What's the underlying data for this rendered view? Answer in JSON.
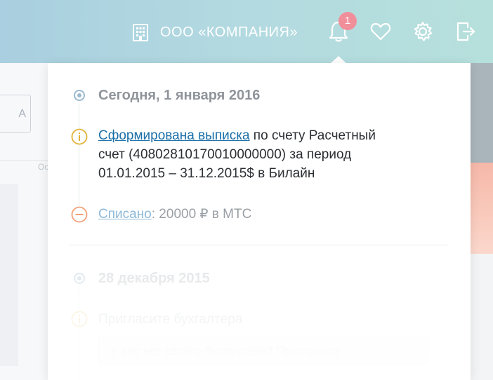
{
  "header": {
    "company_name": "ООО «КОМПАНИЯ»",
    "notification_count": "1",
    "icons": [
      "building-icon",
      "bell-icon",
      "heart-icon",
      "gear-icon",
      "logout-icon"
    ],
    "gradient_colors": [
      "#a9cfe0",
      "#b6e0dc"
    ],
    "badge_color": "#f08f9a"
  },
  "background": {
    "button_fragment": "А",
    "label_fragment": "Ос"
  },
  "notifications": {
    "groups": [
      {
        "date": "Сегодня, 1 января 2016",
        "items": [
          {
            "type": "info",
            "link": "Сформирована выписка",
            "line1": " по счету Расчетный",
            "line2": "счет (40802810170010000000) за период",
            "line3": "01.01.2015 – 31.12.2015$ в Билайн"
          },
          {
            "type": "debit",
            "link": "Списано",
            "rest": ": 20000 ₽ в МТС"
          }
        ]
      },
      {
        "date": "28 декабря 2015",
        "items": [
          {
            "type": "info",
            "text": "Пригласите бухгалтера",
            "box_text": "У вас нет своего бухгалтера? Пригласите"
          }
        ]
      }
    ],
    "colors": {
      "link": "#1b6fa8",
      "info": "#e2b33a",
      "debit": "#f1a27b",
      "date_marker": "#9bb9cf"
    }
  }
}
